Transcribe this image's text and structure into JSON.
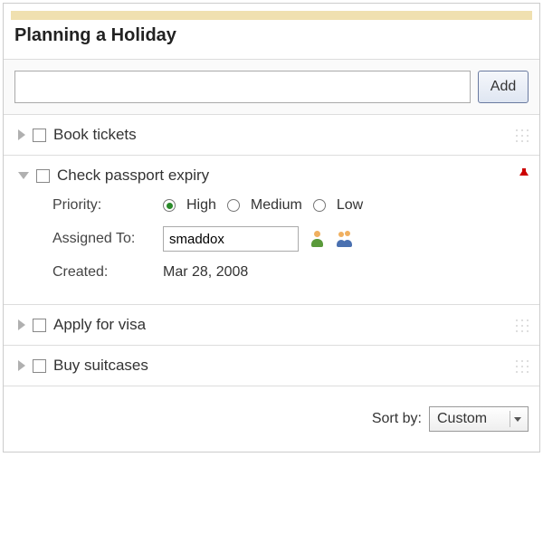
{
  "title": "Planning a Holiday",
  "add": {
    "placeholder": "",
    "button_label": "Add"
  },
  "tasks": [
    {
      "label": "Book tickets",
      "expanded": false
    },
    {
      "label": "Check passport expiry",
      "expanded": true,
      "priority_label": "Priority:",
      "priority_options": {
        "high": "High",
        "medium": "Medium",
        "low": "Low"
      },
      "priority_selected": "high",
      "assigned_label": "Assigned To:",
      "assigned_value": "smaddox",
      "created_label": "Created:",
      "created_value": "Mar 28, 2008"
    },
    {
      "label": "Apply for visa",
      "expanded": false
    },
    {
      "label": "Buy suitcases",
      "expanded": false
    }
  ],
  "footer": {
    "sort_label": "Sort by:",
    "sort_value": "Custom"
  }
}
